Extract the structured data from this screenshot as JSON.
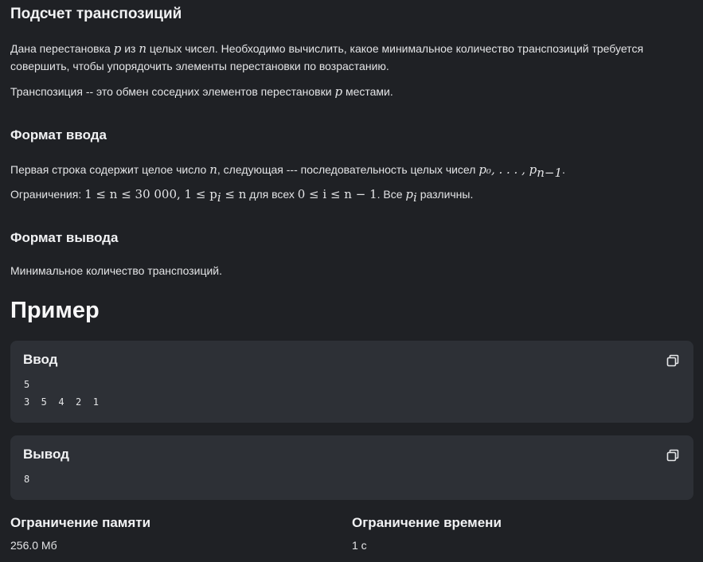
{
  "problem": {
    "title": "Подсчет транспозиций",
    "statement": {
      "line1_a": "Дана перестановка ",
      "var_p": "p",
      "line1_b": " из ",
      "var_n": "n",
      "line1_c": " целых чисел. Необходимо вычислить, какое минимальное количество транспозиций требуется",
      "line2": "совершить, чтобы упорядочить элементы перестановки по возрастанию.",
      "line3_a": "Транспозиция -- это обмен соседних элементов перестановки ",
      "line3_b": " местами."
    }
  },
  "input_format": {
    "heading": "Формат ввода",
    "line1_a": "Первая строка содержит целое число ",
    "line1_b": ", следующая --- последовательность целых чисел ",
    "line1_seq": "p₀, . . . , p",
    "line1_sub": "n−1",
    "line1_end": ".",
    "line2_a": "Ограничения: ",
    "line2_m1": "1 ≤ n ≤ 30 000, 1 ≤ p",
    "line2_m1_sub": "i",
    "line2_m1_b": " ≤ n",
    "line2_b": " для всех ",
    "line2_m2": "0 ≤ i ≤ n − 1",
    "line2_c": ". Все ",
    "line2_m3": "p",
    "line2_m3_sub": "i",
    "line2_d": " различны."
  },
  "output_format": {
    "heading": "Формат вывода",
    "text": "Минимальное количество транспозиций."
  },
  "example": {
    "heading": "Пример",
    "input": {
      "label": "Ввод",
      "line1": "5",
      "line2": "3  5  4  2  1",
      "copy_icon": "copy-icon"
    },
    "output": {
      "label": "Вывод",
      "line1": "8",
      "copy_icon": "copy-icon"
    }
  },
  "limits": {
    "memory_label": "Ограничение памяти",
    "memory_value": "256.0 Мб",
    "time_label": "Ограничение времени",
    "time_value": "1 с"
  }
}
